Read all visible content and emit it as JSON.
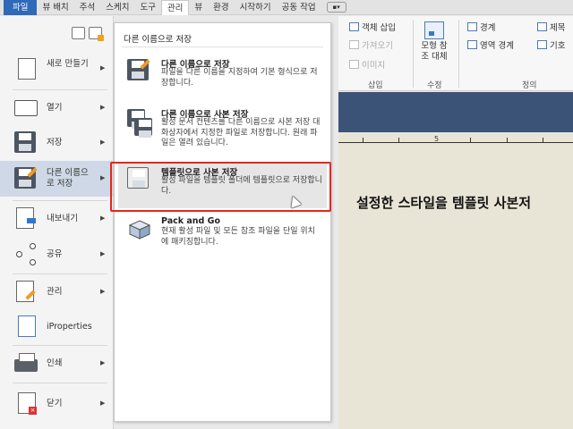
{
  "tabs": [
    "파일",
    "뷰 배치",
    "주석",
    "스케치",
    "도구",
    "관리",
    "뷰",
    "환경",
    "시작하기",
    "공동 작업"
  ],
  "active_tab": "관리",
  "ribbon": {
    "object_insert": "객체 삽입",
    "import": "가져오기",
    "image": "이미지",
    "insert_group": "삽입",
    "model_ref_replace": "모형 참조 대체",
    "modify_group": "수정",
    "boundary": "경계",
    "region_boundary": "영역 경계",
    "title": "제목",
    "symbol": "기호",
    "define_group": "정의"
  },
  "left_menu": {
    "items": [
      {
        "label": "새로 만들기",
        "icon": "new-file-icon"
      },
      {
        "label": "열기",
        "icon": "folder-icon"
      },
      {
        "label": "저장",
        "icon": "save-icon"
      },
      {
        "label": "다른 이름으로 저장",
        "icon": "save-as-icon"
      },
      {
        "label": "내보내기",
        "icon": "export-icon"
      },
      {
        "label": "공유",
        "icon": "share-icon"
      },
      {
        "label": "관리",
        "icon": "manage-icon"
      },
      {
        "label": "iProperties",
        "icon": "iproperties-icon"
      },
      {
        "label": "인쇄",
        "icon": "print-icon"
      },
      {
        "label": "닫기",
        "icon": "close-file-icon"
      }
    ]
  },
  "submenu": {
    "title": "다른 이름으로 저장",
    "options": [
      {
        "title": "다른 이름으로 저장",
        "desc": "파일을 다른 이름을 지정하여 기본 형식으로 저장합니다."
      },
      {
        "title": "다른 이름으로 사본 저장",
        "desc": "활성 문서 컨텐츠를 다른 이름으로 사본 저장 대화상자에서 지정한 파일로 저장합니다. 원래 파일은 열려 있습니다."
      },
      {
        "title": "템플릿으로 사본 저장",
        "desc": "활성 파일을 템플릿 폴더에 템플릿으로 저장합니다."
      },
      {
        "title": "Pack and Go",
        "desc": "현재 활성 파일 및 모든 참조 파일을 단일 위치에 패키징합니다."
      }
    ]
  },
  "ruler": {
    "label": "5"
  },
  "caption": "설정한 스타일을 템플릿 사본저",
  "colors": {
    "file_tab": "#2f69b8",
    "highlight_box": "#e8251b",
    "canvas_band": "#3c5378"
  }
}
